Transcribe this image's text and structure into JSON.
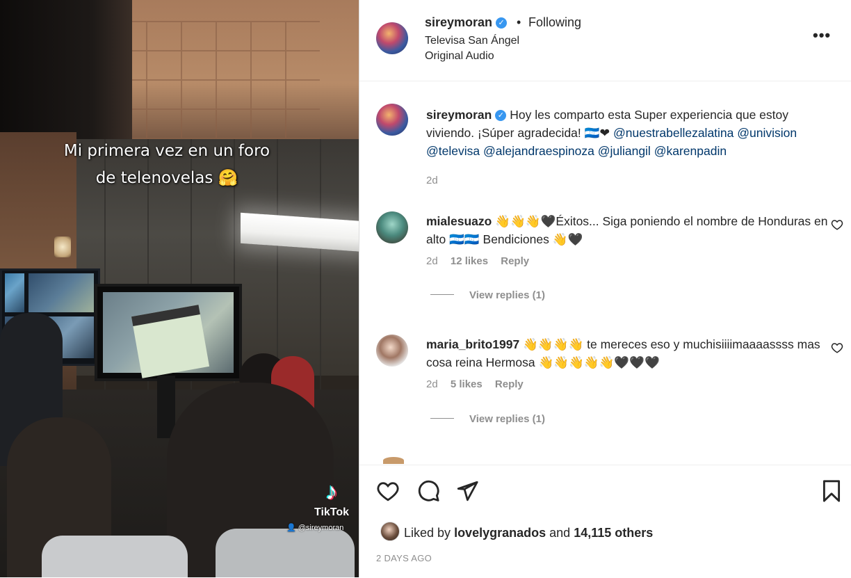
{
  "video": {
    "caption_line1": "Mi primera vez en un foro",
    "caption_line2": "de telenovelas 🤗",
    "watermark_brand": "TikTok",
    "watermark_user": "@sireymoran"
  },
  "header": {
    "username": "sireymoran",
    "separator": "•",
    "follow_status": "Following",
    "location": "Televisa San Ángel",
    "audio": "Original Audio",
    "more_icon": "more-horizontal-icon"
  },
  "caption": {
    "username": "sireymoran",
    "text": "Hoy les comparto esta Super experiencia que estoy viviendo. ¡Súper agradecida! 🇭🇳❤",
    "mentions": [
      "@nuestrabellezalatina",
      "@univision",
      "@televisa",
      "@alejandraespinoza",
      "@juliangil",
      "@karenpadin"
    ],
    "time": "2d"
  },
  "comments": [
    {
      "username": "mialesuazo",
      "text": "👋👋👋🖤Éxitos... Siga poniendo el nombre de Honduras en alto 🇭🇳🇭🇳 Bendiciones 👋🖤",
      "time": "2d",
      "likes": "12 likes",
      "reply": "Reply",
      "view_replies": "View replies (1)"
    },
    {
      "username": "maria_brito1997",
      "text": "👋👋👋👋 te mereces eso y muchisiiiimaaaassss mas cosa reina Hermosa 👋👋👋👋👋🖤🖤🖤",
      "time": "2d",
      "likes": "5 likes",
      "reply": "Reply",
      "view_replies": "View replies (1)"
    }
  ],
  "actions": {
    "like_icon": "heart-icon",
    "comment_icon": "comment-icon",
    "share_icon": "send-icon",
    "save_icon": "bookmark-icon"
  },
  "likes": {
    "prefix": "Liked by",
    "user": "lovelygranados",
    "middle": "and",
    "count": "14,115 others"
  },
  "post_date": "2 DAYS AGO",
  "colors": {
    "verified": "#3897f0",
    "mention": "#00376b",
    "muted": "#8e8e8e"
  }
}
